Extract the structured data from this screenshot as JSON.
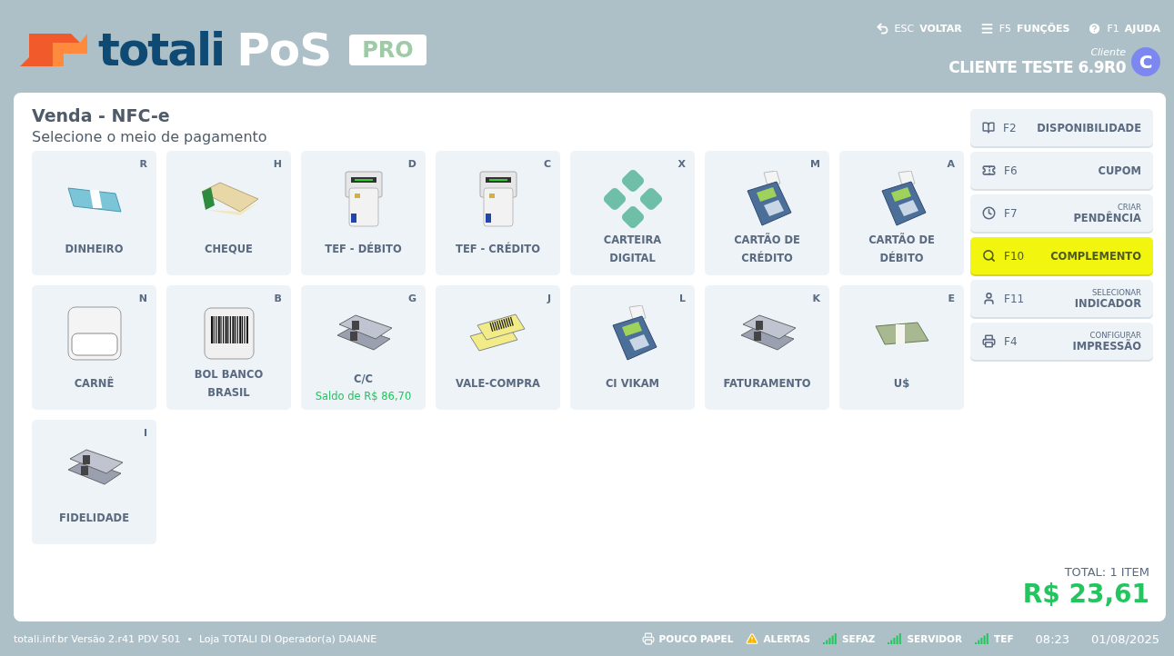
{
  "header": {
    "logo_word": "totali",
    "logo_pos": "PoS",
    "logo_badge": "PRO",
    "actions": [
      {
        "kind": "back",
        "key": "ESC",
        "label": "VOLTAR"
      },
      {
        "kind": "menu",
        "key": "F5",
        "label": "FUNÇÕES"
      },
      {
        "kind": "help",
        "key": "F1",
        "label": "AJUDA"
      }
    ],
    "client": {
      "caption": "Cliente",
      "name": "CLIENTE TESTE 6.9R0",
      "avatar": "C"
    }
  },
  "title": "Venda - NFC-e",
  "subtitle": "Selecione o meio de pagamento",
  "tiles": [
    {
      "kind": "cash",
      "key": "R",
      "label": [
        "DINHEIRO"
      ]
    },
    {
      "kind": "check",
      "key": "H",
      "label": [
        "CHEQUE"
      ]
    },
    {
      "kind": "atm",
      "key": "D",
      "label": [
        "TEF - DÉBITO"
      ]
    },
    {
      "kind": "atm",
      "key": "C",
      "label": [
        "TEF - CRÉDITO"
      ]
    },
    {
      "kind": "diamond",
      "key": "X",
      "label": [
        "CARTEIRA",
        "DIGITAL"
      ]
    },
    {
      "kind": "terminal",
      "key": "M",
      "label": [
        "CARTÃO DE",
        "CRÉDITO"
      ]
    },
    {
      "kind": "terminal",
      "key": "A",
      "label": [
        "CARTÃO DE",
        "DÉBITO"
      ]
    },
    {
      "kind": "carne",
      "key": "N",
      "label": [
        "CARNÊ"
      ]
    },
    {
      "kind": "boleto",
      "key": "B",
      "label": [
        "BOL BANCO",
        "BRASIL"
      ]
    },
    {
      "kind": "idcards",
      "key": "G",
      "label": [
        "C/C"
      ],
      "note": "Saldo de R$ 86,70"
    },
    {
      "kind": "voucher",
      "key": "J",
      "label": [
        "VALE-COMPRA"
      ]
    },
    {
      "kind": "terminal",
      "key": "L",
      "label": [
        "CI VIKAM"
      ]
    },
    {
      "kind": "idcards",
      "key": "K",
      "label": [
        "FATURAMENTO"
      ]
    },
    {
      "kind": "dollars",
      "key": "E",
      "label": [
        "U$"
      ]
    },
    {
      "kind": "idcards",
      "key": "I",
      "label": [
        "FIDELIDADE"
      ]
    }
  ],
  "side_buttons": [
    {
      "kind": "book",
      "key": "F2",
      "label": "DISPONIBILIDADE",
      "selected": false
    },
    {
      "kind": "ticket",
      "key": "F6",
      "label": "CUPOM",
      "selected": false
    },
    {
      "kind": "clock",
      "key": "F7",
      "caption": "CRIAR",
      "label": "PENDÊNCIA",
      "selected": false
    },
    {
      "kind": "search",
      "key": "F10",
      "label": "COMPLEMENTO",
      "selected": true
    },
    {
      "kind": "user",
      "key": "F11",
      "caption": "SELECIONAR",
      "label": "INDICADOR",
      "selected": false
    },
    {
      "kind": "printer",
      "key": "F4",
      "caption": "CONFIGURAR",
      "label": "IMPRESSÃO",
      "selected": false
    }
  ],
  "total": {
    "caption": "TOTAL: 1 ITEM",
    "amount": "R$ 23,61"
  },
  "status_bar": {
    "info": "totali.inf.br Versão 2.r41 PDV 501  •  Loja TOTALI DI Operador(a) DAIANE",
    "items": [
      {
        "kind": "printer",
        "label": "POUCO PAPEL"
      },
      {
        "kind": "warning",
        "label": "ALERTAS"
      },
      {
        "kind": "signal",
        "label": "SEFAZ"
      },
      {
        "kind": "signal",
        "label": "SERVIDOR"
      },
      {
        "kind": "signal",
        "label": "TEF"
      }
    ],
    "time": "08:23",
    "date": "01/08/2025"
  }
}
